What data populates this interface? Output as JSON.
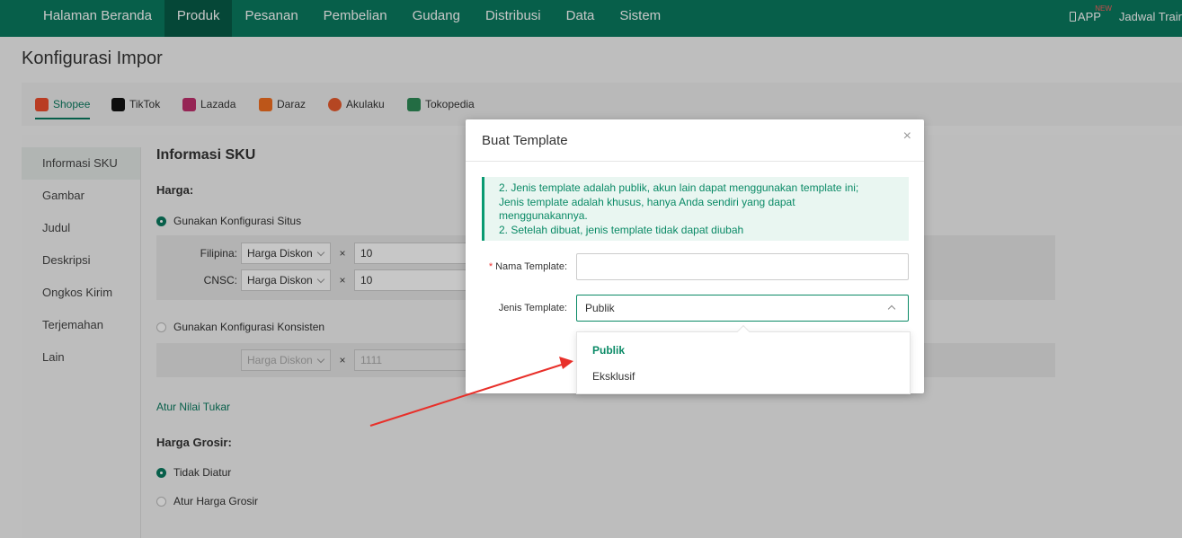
{
  "topnav": {
    "items": [
      "Halaman Beranda",
      "Produk",
      "Pesanan",
      "Pembelian",
      "Gudang",
      "Distribusi",
      "Data",
      "Sistem"
    ],
    "app_label": "APP",
    "new_badge": "NEW",
    "user_label": "Jadwal Trair"
  },
  "page": {
    "title": "Konfigurasi Impor"
  },
  "platforms": [
    {
      "label": "Shopee",
      "color": "#ee4d2d"
    },
    {
      "label": "TikTok",
      "color": "#111111"
    },
    {
      "label": "Lazada",
      "color": "#c0306e"
    },
    {
      "label": "Daraz",
      "color": "#f36f21"
    },
    {
      "label": "Akulaku",
      "color": "#e85a2c"
    },
    {
      "label": "Tokopedia",
      "color": "#2e8b57"
    }
  ],
  "sidenav": [
    "Informasi SKU",
    "Gambar",
    "Judul",
    "Deskripsi",
    "Ongkos Kirim",
    "Terjemahan",
    "Lain"
  ],
  "main": {
    "section_title": "Informasi SKU",
    "harga_label": "Harga:",
    "radio_situs": "Gunakan Konfigurasi Situs",
    "rows": [
      {
        "label": "Filipina:",
        "select": "Harga Diskon",
        "times": "×",
        "value": "10"
      },
      {
        "label": "CNSC:",
        "select": "Harga Diskon",
        "times": "×",
        "value": "10"
      }
    ],
    "radio_konsisten": "Gunakan Konfigurasi Konsisten",
    "konsisten_row": {
      "select": "Harga Diskon",
      "times": "×",
      "value": "1111"
    },
    "link_tukar": "Atur Nilai Tukar",
    "grosir_label": "Harga Grosir:",
    "radio_tidak": "Tidak Diatur",
    "radio_atur": "Atur Harga Grosir"
  },
  "modal": {
    "title": "Buat Template",
    "close": "×",
    "notice_lines": [
      "2. Jenis template adalah publik, akun lain dapat menggunakan template ini;",
      "Jenis template adalah khusus, hanya Anda sendiri yang dapat",
      "menggunakannya.",
      "2. Setelah dibuat, jenis template tidak dapat diubah"
    ],
    "name_label": "Nama Template:",
    "name_required": "*",
    "name_value": "",
    "type_label": "Jenis Template:",
    "type_value": "Publik",
    "options": [
      "Publik",
      "Eksklusif"
    ]
  },
  "colors": {
    "brand": "#0a7a5f",
    "annotation_arrow": "#e8302a"
  }
}
